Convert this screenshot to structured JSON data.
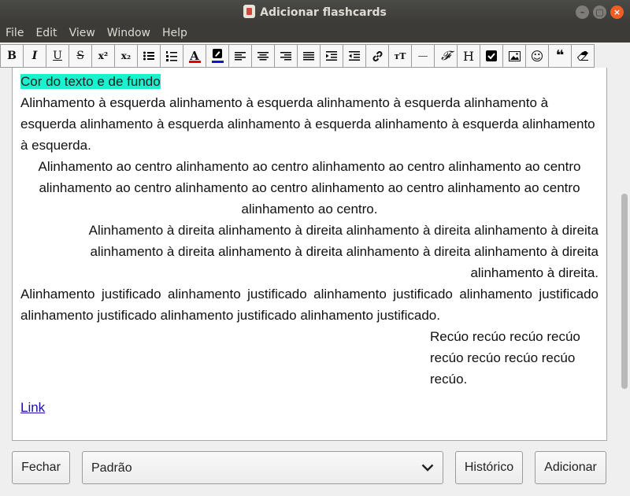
{
  "window": {
    "title": "Adicionar flashcards",
    "controls": [
      "–",
      "▢",
      "×"
    ]
  },
  "menu": [
    "File",
    "Edit",
    "View",
    "Window",
    "Help"
  ],
  "toolbar": [
    {
      "name": "bold-button",
      "glyph": "B"
    },
    {
      "name": "italic-button",
      "glyph": "I"
    },
    {
      "name": "underline-button",
      "glyph": "U"
    },
    {
      "name": "strikethrough-button",
      "glyph": "S"
    },
    {
      "name": "superscript-button",
      "glyph": "x²"
    },
    {
      "name": "subscript-button",
      "glyph": "x₂"
    },
    {
      "name": "bullet-list-button",
      "glyph": ""
    },
    {
      "name": "numbered-list-button",
      "glyph": ""
    },
    {
      "name": "text-color-button",
      "glyph": "A"
    },
    {
      "name": "highlight-color-button",
      "glyph": ""
    },
    {
      "name": "align-left-button",
      "glyph": ""
    },
    {
      "name": "align-center-button",
      "glyph": ""
    },
    {
      "name": "align-right-button",
      "glyph": ""
    },
    {
      "name": "align-justify-button",
      "glyph": ""
    },
    {
      "name": "indent-button",
      "glyph": ""
    },
    {
      "name": "outdent-button",
      "glyph": ""
    },
    {
      "name": "link-button",
      "glyph": ""
    },
    {
      "name": "font-size-button",
      "glyph": "ᴛT"
    },
    {
      "name": "horizontal-rule-button",
      "glyph": "—"
    },
    {
      "name": "font-button",
      "glyph": "𝓕"
    },
    {
      "name": "heading-button",
      "glyph": "H"
    },
    {
      "name": "checkbox-button",
      "glyph": ""
    },
    {
      "name": "image-button",
      "glyph": ""
    },
    {
      "name": "emoji-button",
      "glyph": "☺"
    },
    {
      "name": "blockquote-button",
      "glyph": "❝"
    },
    {
      "name": "eraser-button",
      "glyph": ""
    }
  ],
  "editor": {
    "highlighted": "Cor do texto e de fundo",
    "left": "Alinhamento à esquerda alinhamento à esquerda alinhamento à esquerda alinhamento à esquerda alinhamento à esquerda alinhamento à esquerda alinhamento à esquerda alinhamento à esquerda.",
    "center": "Alinhamento ao centro alinhamento ao centro alinhamento ao centro alinhamento ao centro alinhamento ao centro alinhamento ao centro alinhamento ao centro alinhamento ao centro alinhamento ao centro.",
    "right": "Alinhamento à direita alinhamento à direita alinhamento à direita alinhamento à direita alinhamento à direita alinhamento à direita alinhamento à direita alinhamento à direita alinhamento à direita.",
    "justify": "Alinhamento justificado alinhamento justificado alinhamento justificado alinhamento justificado alinhamento justificado alinhamento justificado alinhamento justificado.",
    "indent": "Recúo recúo recúo recúo recúo recúo recúo recúo recúo.",
    "link": "Link"
  },
  "footer": {
    "close": "Fechar",
    "deck": "Padrão",
    "history": "Histórico",
    "add": "Adicionar"
  },
  "colors": {
    "highlight": "#18f2ce",
    "text_color_bar": "#e00000",
    "highlight_color_bar": "#1010e0"
  }
}
